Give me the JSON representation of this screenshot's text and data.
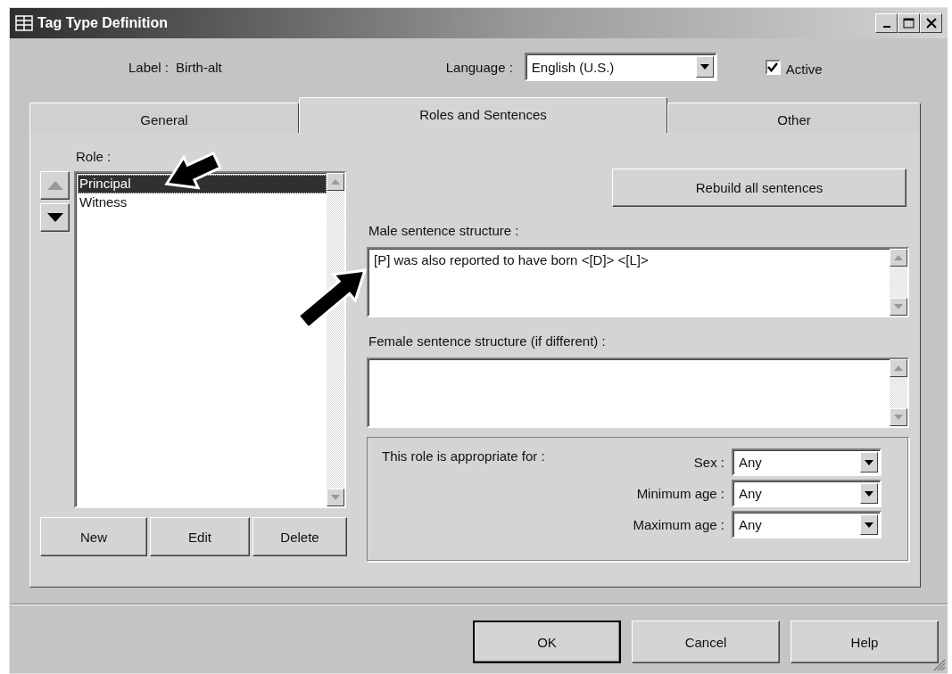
{
  "window": {
    "title": "Tag Type Definition"
  },
  "label": {
    "caption": "Label :",
    "value": "Birth-alt"
  },
  "language": {
    "caption": "Language :",
    "value": "English (U.S.)"
  },
  "active": {
    "label": "Active",
    "checked": true
  },
  "tabs": [
    {
      "label": "General",
      "selected": false
    },
    {
      "label": "Roles and Sentences",
      "selected": true
    },
    {
      "label": "Other",
      "selected": false
    }
  ],
  "roles": {
    "caption": "Role :",
    "items": [
      {
        "label": "Principal",
        "selected": true
      },
      {
        "label": "Witness",
        "selected": false
      }
    ]
  },
  "role_buttons": [
    "New",
    "Edit",
    "Delete"
  ],
  "rebuild_button": "Rebuild all sentences",
  "male_sentence": {
    "caption": "Male sentence structure :",
    "value": "[P] was also reported to have born <[D]> <[L]>"
  },
  "female_sentence": {
    "caption": "Female sentence structure (if different) :"
  },
  "appropriate": {
    "caption": "This role is appropriate for :",
    "fields": [
      {
        "label": "Sex :",
        "value": "Any"
      },
      {
        "label": "Minimum age :",
        "value": "Any"
      },
      {
        "label": "Maximum age :",
        "value": "Any"
      }
    ]
  },
  "buttons": [
    "OK",
    "Cancel",
    "Help"
  ]
}
